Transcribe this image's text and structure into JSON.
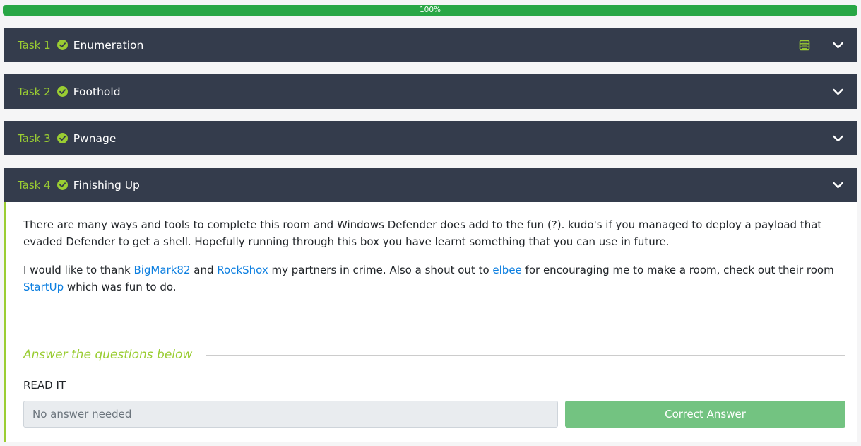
{
  "progress": {
    "label": "100%",
    "value": 1.0
  },
  "colors": {
    "accent": "#9acd32",
    "header_bg": "#343c4c",
    "progress": "#28a745",
    "link": "#0d7fe0",
    "correct": "#73c381"
  },
  "tasks": [
    {
      "number": "Task 1",
      "title": "Enumeration",
      "status_icon": "check-circle-icon",
      "has_notes_icon": true
    },
    {
      "number": "Task 2",
      "title": "Foothold",
      "status_icon": "check-circle-icon"
    },
    {
      "number": "Task 3",
      "title": "Pwnage",
      "status_icon": "check-circle-icon"
    },
    {
      "number": "Task 4",
      "title": "Finishing Up",
      "status_icon": "check-circle-icon",
      "expanded": true
    }
  ],
  "task4_content": {
    "paragraph1": "There are many ways and tools to complete this room and Windows Defender does add to the fun (?). kudo's if you managed to deploy a payload that evaded Defender to get a shell. Hopefully running through this box you have learnt something that you can use in future.",
    "paragraph2": {
      "t1": "I would like to thank ",
      "link1": "BigMark82",
      "t2": " and ",
      "link2": "RockShox",
      "t3": " my partners in crime. Also a shout out to ",
      "link3": "elbee",
      "t4": " for encouraging me to make a room, check out their room ",
      "link4": "StartUp",
      "t5": " which was fun to do."
    },
    "answers_heading": "Answer the questions below",
    "question": "READ IT",
    "answer_placeholder": "No answer needed",
    "button_label": "Correct Answer"
  }
}
